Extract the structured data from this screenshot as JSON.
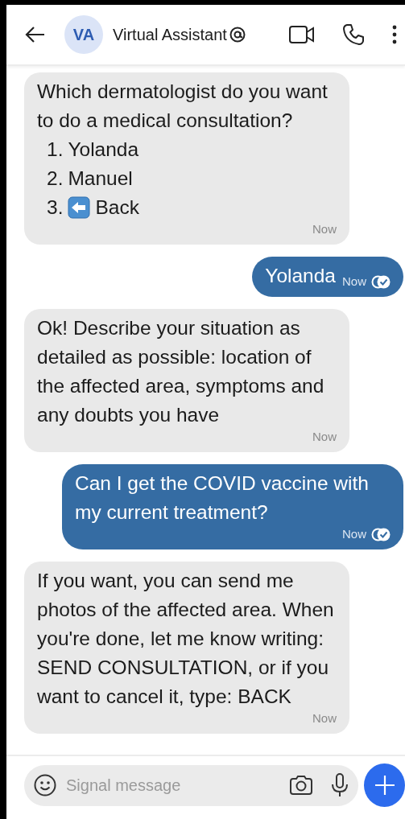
{
  "header": {
    "avatar_initials": "VA",
    "title": "Virtual Assistant"
  },
  "messages": [
    {
      "kind": "incoming",
      "text": "Which dermatologist do you want to do a medical consultation?",
      "list": [
        {
          "number": "1.",
          "text": "Yolanda",
          "kind": "plain"
        },
        {
          "number": "2.",
          "text": "Manuel",
          "kind": "plain"
        },
        {
          "number": "3.",
          "text": "Back",
          "kind": "back-emoji"
        }
      ],
      "time": "Now"
    },
    {
      "kind": "outgoing",
      "text": "Yolanda",
      "time": "Now"
    },
    {
      "kind": "incoming",
      "text": "Ok! Describe your situation as detailed as possible: location of the affected area, symptoms and any doubts you have",
      "time": "Now"
    },
    {
      "kind": "outgoing",
      "text": "Can I get the COVID vaccine with my current treatment?",
      "time": "Now"
    },
    {
      "kind": "incoming",
      "text": "If you want, you can send me photos of the affected area. When you're done, let me know writing: SEND CONSULTATION, or if you want to cancel it, type: BACK",
      "time": "Now"
    }
  ],
  "composer": {
    "placeholder": "Signal message"
  }
}
